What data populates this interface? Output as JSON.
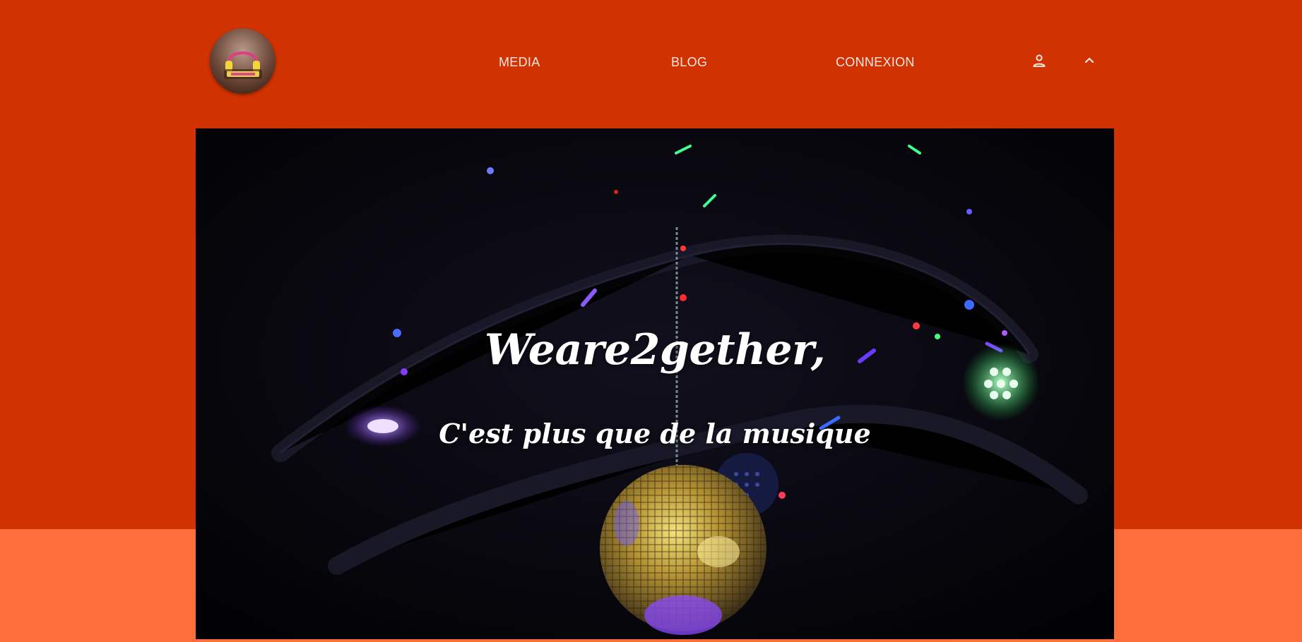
{
  "nav": {
    "items": [
      {
        "label": "MEDIA"
      },
      {
        "label": "BLOG"
      },
      {
        "label": "CONNEXION"
      }
    ],
    "user_icon": "user-icon",
    "chevron_icon": "chevron-up-icon"
  },
  "logo": {
    "icon": "headphones-logo"
  },
  "hero": {
    "title": "Weare2gether,",
    "subtitle": "C'est plus que de la musique",
    "image": "disco-ball-with-colored-stage-lights"
  },
  "colors": {
    "header_bg": "#d13201",
    "page_bg": "#ff6e3a",
    "nav_text": "#f6e7e2",
    "hero_text": "#ffffff"
  }
}
